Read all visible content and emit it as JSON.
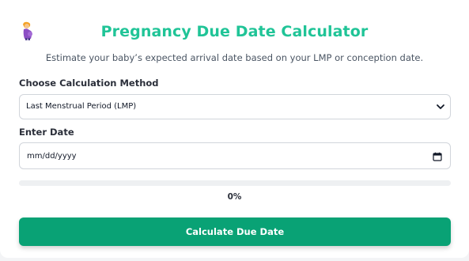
{
  "header": {
    "icon": "pregnant-woman-icon",
    "title": "Pregnancy Due Date Calculator",
    "subtitle": "Estimate your baby’s expected arrival date based on your LMP or conception date."
  },
  "form": {
    "method_label": "Choose Calculation Method",
    "method_selected": "Last Menstrual Period (LMP)",
    "date_label": "Enter Date",
    "date_placeholder": "mm/dd/yyyy"
  },
  "progress": {
    "fraction": 0,
    "text": "0%"
  },
  "actions": {
    "calculate_label": "Calculate Due Date"
  },
  "colors": {
    "title": "#20c497",
    "button": "#09a275",
    "progress_track": "#eef0f2"
  }
}
